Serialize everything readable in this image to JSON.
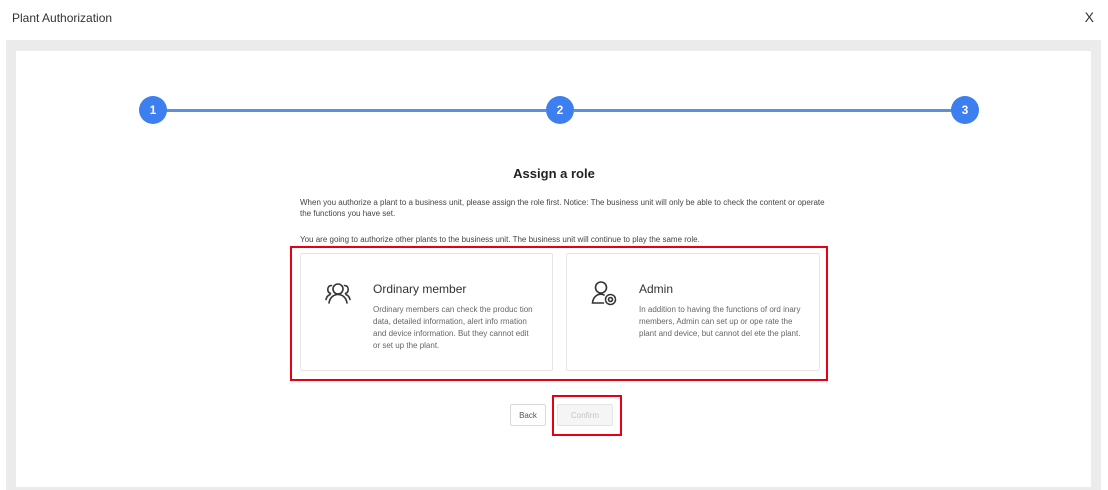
{
  "header": {
    "title": "Plant Authorization",
    "close_label": "X"
  },
  "steps": [
    {
      "number": "1",
      "status": "done"
    },
    {
      "number": "2",
      "status": "current"
    },
    {
      "number": "3",
      "status": "pending"
    }
  ],
  "main": {
    "heading": "Assign a role",
    "description_1": "When you authorize a plant to a business unit, please assign the role first. Notice: The business unit will only be able to check the content or operate the functions you have set.",
    "description_2": "You are going to authorize other plants to the business unit. The business unit will continue to play the same role.",
    "roles": [
      {
        "icon": "users-icon",
        "title": "Ordinary member",
        "description": "Ordinary members can check the produc tion data, detailed information, alert info rmation and device information. But they cannot edit or set up the plant."
      },
      {
        "icon": "user-gear-icon",
        "title": "Admin",
        "description": "In addition to having the functions of ord inary members, Admin can set up or ope rate the plant and device, but cannot del ete the plant."
      }
    ]
  },
  "footer": {
    "back_label": "Back",
    "confirm_label": "Confirm"
  },
  "colors": {
    "accent": "#3d7ef0",
    "line": "#5b8fe3",
    "highlight": "#e50012"
  }
}
